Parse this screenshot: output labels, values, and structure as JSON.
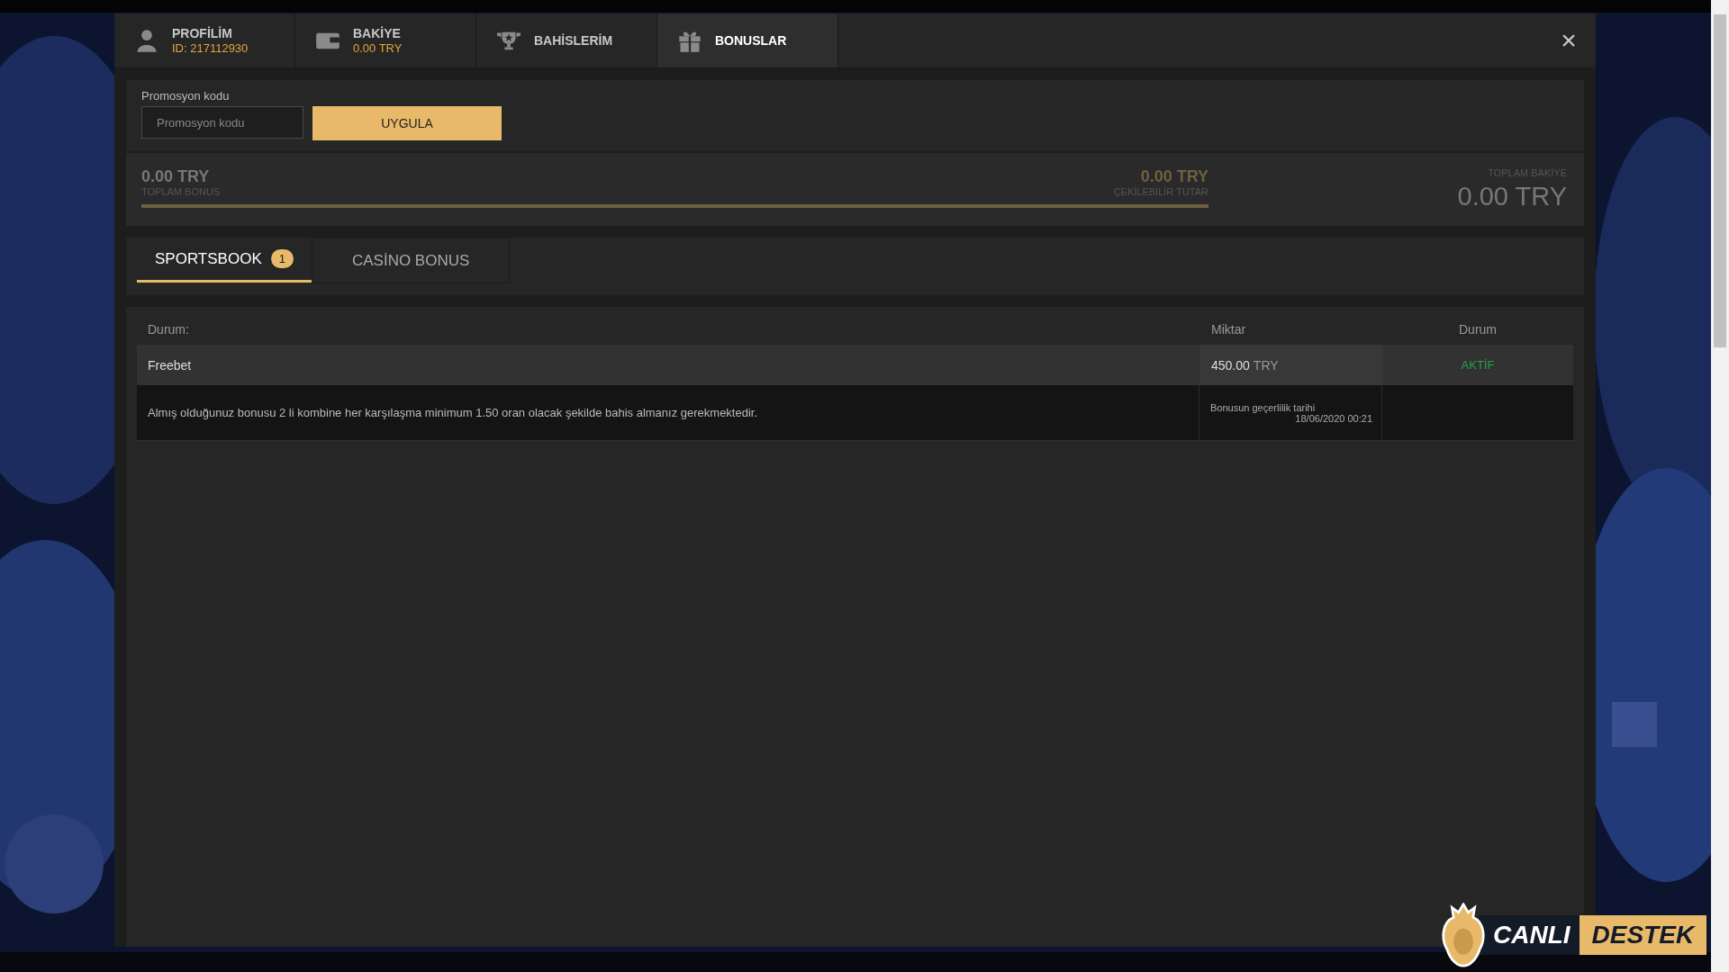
{
  "header_tabs": [
    {
      "kind": "profile",
      "title": "PROFİLİM",
      "subtitle": "ID: 217112930",
      "selected": false
    },
    {
      "kind": "wallet",
      "title": "BAKİYE",
      "subtitle": "0.00 TRY",
      "selected": false
    },
    {
      "kind": "trophy",
      "title": "BAHİSLERİM",
      "selected": false
    },
    {
      "kind": "gift",
      "title": "BONUSLAR",
      "selected": true
    }
  ],
  "close": "×",
  "promo": {
    "label": "Promosyon kodu",
    "placeholder": "Promosyon kodu",
    "button": "UYGULA"
  },
  "balance": {
    "bonus_amount": "0.00 TRY",
    "bonus_label": "TOPLAM BONUS",
    "withdraw_amount": "0.00 TRY",
    "withdraw_label": "ÇEKİLEBİLİR TUTAR",
    "level": 1,
    "total_label": "TOPLAM BAKİYE",
    "total_amount": "0.00 TRY"
  },
  "bonus_tabs": [
    {
      "label": "SPORTSBOOK",
      "badge": "1",
      "selected": true
    },
    {
      "label": "CASİNO BONUS",
      "selected": false
    }
  ],
  "table": {
    "columns": [
      "Durum:",
      "Miktar",
      "Durum"
    ],
    "rows": [
      {
        "name": "Freebet",
        "amount": "450.00",
        "currency": "TRY",
        "status": "AKTİF",
        "description": "Almış olduğunuz bonusu 2 li kombine her karşılaşma minimum 1.50 oran olacak şekilde bahis almanız gerekmektedir.",
        "validity_label": "Bonusun geçerlilik tarihi",
        "validity_date": "18/06/2020 00:21"
      }
    ]
  },
  "support": {
    "word1": "CANLI",
    "word2": "DESTEK"
  }
}
